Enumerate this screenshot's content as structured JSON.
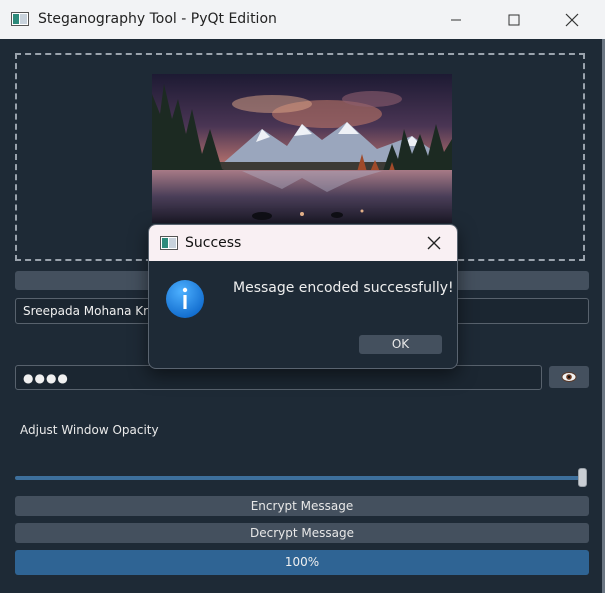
{
  "window": {
    "title": "Steganography Tool - PyQt Edition"
  },
  "inputs": {
    "name_value": "Sreepada Mohana Kris",
    "password_value": "●●●●"
  },
  "labels": {
    "opacity": "Adjust Window Opacity"
  },
  "buttons": {
    "encrypt": "Encrypt Message",
    "decrypt": "Decrypt Message"
  },
  "slider": {
    "opacity_level": 1.0
  },
  "progress": {
    "value": 1.0,
    "text": "100%"
  },
  "dialog": {
    "title": "Success",
    "message": "Message encoded successfully!",
    "ok_label": "OK"
  },
  "colors": {
    "background": "#1e2a36",
    "accent": "#2f6494",
    "button": "#44505e",
    "dialog_title_bar": "#f9f0f3",
    "info_icon": "#1b7fd8"
  },
  "icons": [
    "app-icon",
    "minimize-icon",
    "maximize-icon",
    "close-icon",
    "eye-icon",
    "info-icon"
  ]
}
